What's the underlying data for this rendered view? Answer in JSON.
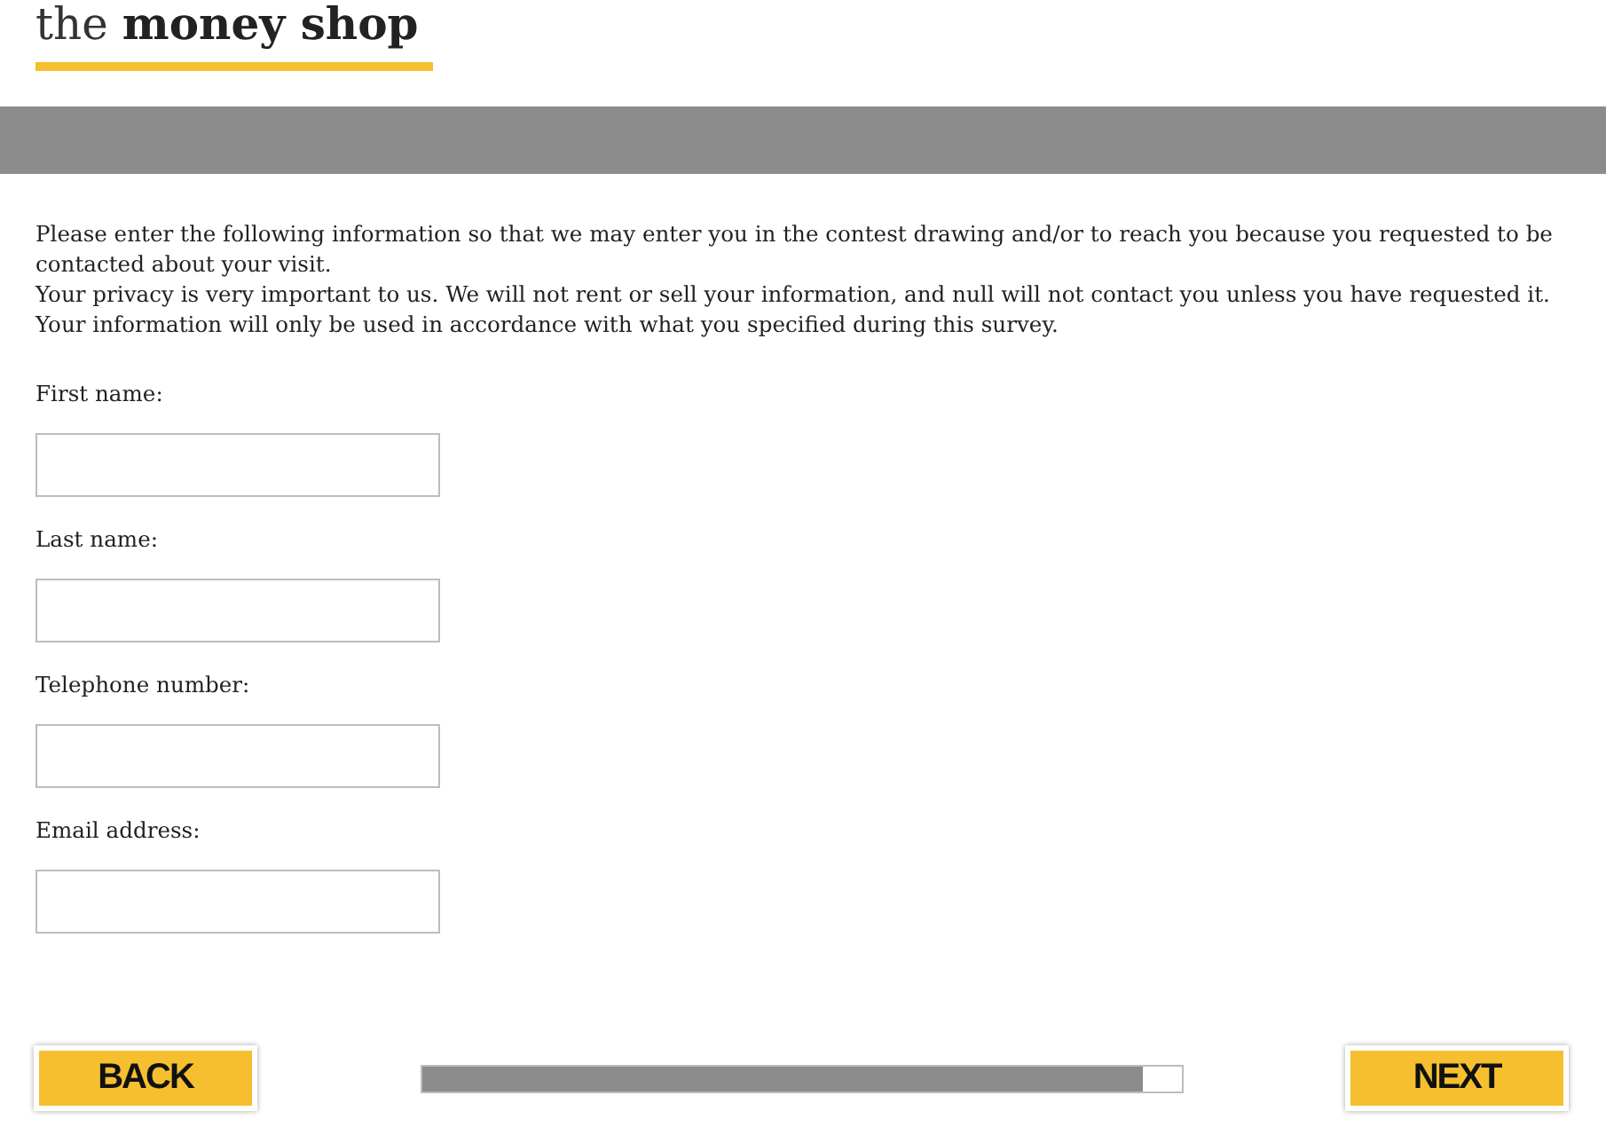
{
  "logo": "the **money shop**",
  "intro": [
    "Please enter the following information so that we may enter you in the contest drawing and/or to reach you because you requested to be contacted about your visit.",
    "Your privacy is very important to us. We will not rent or sell your information, and null will not contact you unless you have requested it. Your information will only be used in accordance with what you specified during this survey."
  ],
  "fields": [
    {
      "label": "First name:"
    },
    {
      "label": "Last name:"
    },
    {
      "label": "Telephone number:"
    },
    {
      "label": "Email address:"
    }
  ],
  "back_button": "BACK",
  "progress": {
    "level": 0.95
  },
  "next_button": "NEXT"
}
